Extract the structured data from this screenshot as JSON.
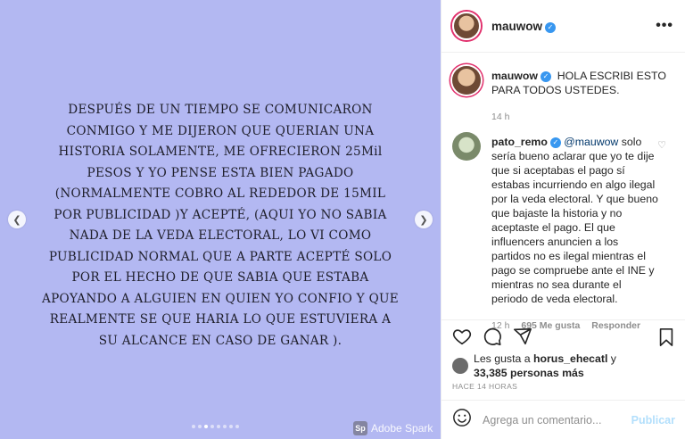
{
  "media": {
    "text": "DESPUÉS DE UN TIEMPO SE COMUNICARON\nCONMIGO Y ME DIJERON QUE QUERIAN UNA\nHISTORIA SOLAMENTE, ME OFRECIERON 25Mil\nPESOS Y YO PENSE ESTA BIEN PAGADO\n(NORMALMENTE COBRO AL REDEDOR DE 15MIL\nPOR PUBLICIDAD )Y ACEPTÉ, (AQUI YO NO SABIA\nNADA DE LA VEDA ELECTORAL, LO VI COMO\nPUBLICIDAD NORMAL QUE A PARTE ACEPTÉ SOLO\nPOR EL HECHO DE QUE SABIA QUE ESTABA\nAPOYANDO A ALGUIEN EN QUIEN YO CONFIO Y QUE\nREALMENTE SE QUE HARIA LO QUE ESTUVIERA A\nSU ALCANCE EN CASO DE GANAR ).",
    "background": "#b3b8f2",
    "watermark": "Adobe Spark",
    "watermark_logo": "Sp",
    "slides_total": 8,
    "slide_active": 3
  },
  "post": {
    "username": "mauwow",
    "verified_icon": "✓",
    "more_icon": "•••"
  },
  "caption": {
    "username": "mauwow",
    "text": "HOLA ESCRIBI ESTO PARA TODOS USTEDES.",
    "time": "14 h"
  },
  "comment": {
    "username": "pato_remo",
    "mention": "@mauwow",
    "text": " solo sería bueno aclarar que yo te dije que si aceptabas el pago sí estabas incurriendo en algo ilegal por la veda electoral. Y que bueno que bajaste la historia y no aceptaste el pago. El que influencers anuncien a los partidos no es ilegal mientras el pago se compruebe ante el INE y mientras no sea durante el periodo de veda electoral.",
    "time": "12 h",
    "likes": "695 Me gusta",
    "reply": "Responder"
  },
  "likes": {
    "prefix": "Les gusta a ",
    "user": "horus_ehecatl",
    "middle": " y",
    "count": "33,385 personas más"
  },
  "timestamp": "HACE 14 HORAS",
  "add_comment": {
    "placeholder": "Agrega un comentario...",
    "publish": "Publicar"
  },
  "colors": {
    "accent": "#3897f0",
    "publish_disabled": "#b2dffc"
  }
}
